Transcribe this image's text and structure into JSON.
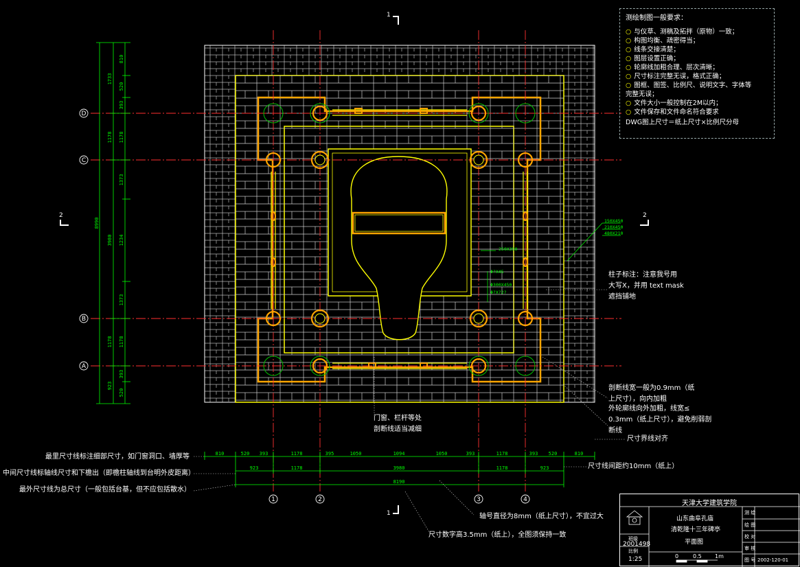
{
  "section_marks": {
    "top": "1",
    "bottom": "1",
    "left": "2",
    "right": "2"
  },
  "axis_labels": {
    "rows": [
      "D",
      "C",
      "B",
      "A"
    ],
    "cols": [
      "1",
      "2",
      "3",
      "4"
    ]
  },
  "left_dims": {
    "outer": [
      "1733",
      "1178",
      "3980",
      "1178",
      "923"
    ],
    "inner": [
      "810",
      "520",
      "393",
      "1178",
      "1373",
      "1234",
      "1373",
      "1178",
      "393",
      "520"
    ],
    "total": "8990"
  },
  "bottom_dims": {
    "row1": [
      "810",
      "520",
      "393",
      "1178",
      "395",
      "1050",
      "1094",
      "1050",
      "393",
      "1178",
      "393",
      "520",
      "810"
    ],
    "row2": [
      "923",
      "1178",
      "3980",
      "1178",
      "923"
    ],
    "total": "8190"
  },
  "material_labels": [
    "150X450",
    "210X450",
    "480X210"
  ],
  "inner_labels": [
    "250X350",
    "Φ?X45",
    "Φ300X450",
    "Φ?X?2?"
  ],
  "requirements": {
    "title": "测绘制图一般要求：",
    "items": [
      "与仪草、测稿及拓拌（原物）一致；",
      "构图均衡、疏密得当；",
      "线条交接清楚；",
      "图层设置正确；",
      "轮廓线加粗合理、层次清晰；",
      "尺寸标注完整无误，格式正确；",
      "图框、图签、比例尺、说明文字、字体等",
      "文件大小一般控制在2M以内；",
      "文件保存和文件命名符合要求"
    ],
    "item7_cont": "完整无误；",
    "footer": "DWG图上尺寸＝纸上尺寸×比例尺分母"
  },
  "annotations": {
    "column_note": [
      "柱子标注：注意我号用",
      "大写X，并用 text mask",
      "遮挡铺地"
    ],
    "section_line": [
      "剖断线宽一般为0.9mm（纸",
      "上尺寸），向内加粗"
    ],
    "outline": [
      "外轮廓线向外加粗，线宽≤",
      "0.3mm（纸上尺寸），避免削弱剖",
      "断线"
    ],
    "doors": [
      "门窗、栏杆等处",
      "剖断线适当减细"
    ],
    "dim_align": "尺寸界线对齐",
    "dim_outer_detail": "最里尺寸线标注细部尺寸，如门窗洞口、墙厚等",
    "dim_middle": "中间尺寸线标轴线尺寸和下檐出（即檐柱轴线到台明外皮距离）",
    "dim_outermost": "最外尺寸线为总尺寸（一般包括台基，但不应包括散水）",
    "dim_spacing": "尺寸线间距约10mm（纸上）",
    "axis_diam": "轴号直径为8mm（纸上尺寸），不宜过大",
    "dim_text": "尺寸数字高3.5mm（纸上），全图须保持一致"
  },
  "title_block": {
    "school": "天津大学建筑学院",
    "project_line1": "山东曲阜孔庙",
    "project_line2": "清乾隆十三年碑亭",
    "drawing": "平面图",
    "student_id_label": "班级",
    "student_id": "2001498",
    "scale_label": "比例",
    "scale": "1:25",
    "scale_bar": [
      "0",
      "0.5",
      "1m"
    ],
    "fields": [
      "测 绘",
      "绘 图",
      "校 对",
      "审 核",
      "图 号"
    ],
    "drawing_no": "2002-120-01"
  },
  "colors": {
    "bg": "#000000",
    "axis": "#ff3030",
    "outline": "#ffff00",
    "column": "#ffa500",
    "paving": "#d0d0d0",
    "dim": "#00ff00",
    "green_col": "#00c000"
  }
}
